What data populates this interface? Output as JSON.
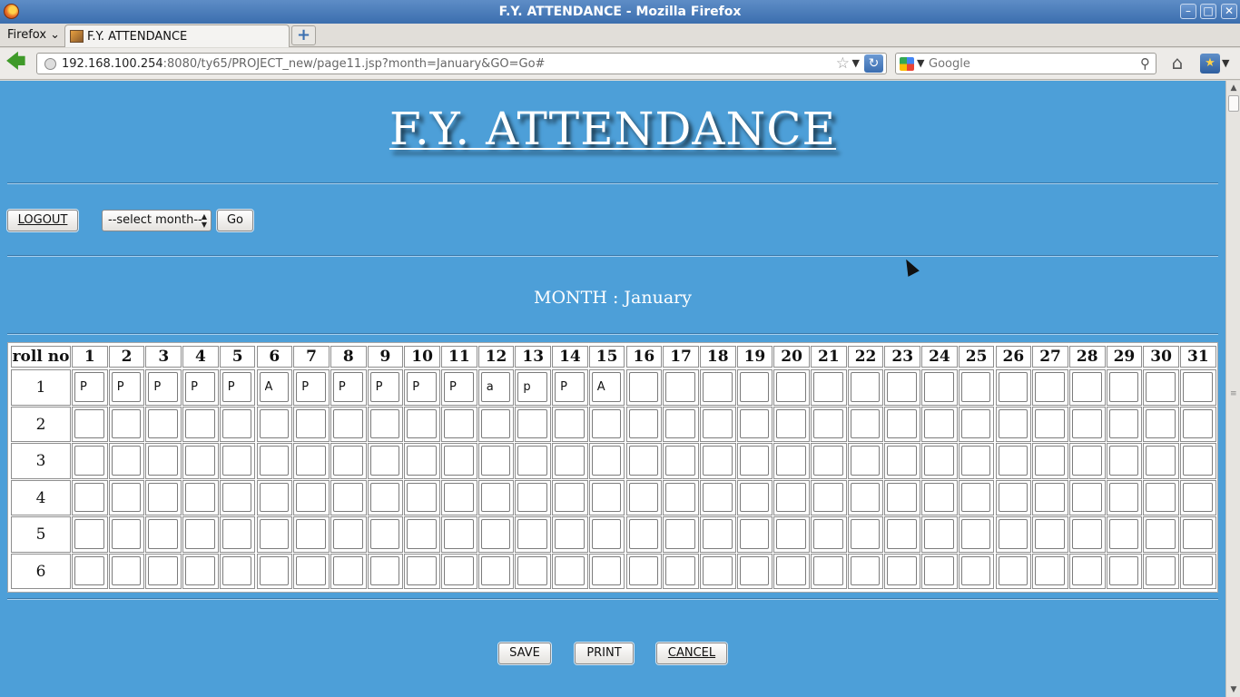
{
  "window": {
    "title": "F.Y. ATTENDANCE - Mozilla Firefox"
  },
  "browser": {
    "menu_label": "Firefox",
    "tab_title": "F.Y. ATTENDANCE",
    "url_host": "192.168.100.254",
    "url_rest": ":8080/ty65/PROJECT_new/page11.jsp?month=January&GO=Go#",
    "search_placeholder": "Google"
  },
  "page": {
    "title": "F.Y. ATTENDANCE",
    "logout_label": "LOGOUT",
    "month_select_value": "--select month--",
    "go_label": "Go",
    "month_prefix": "MONTH : ",
    "month_value": "January",
    "month_text": "MONTH : January",
    "save_label": "SAVE",
    "print_label": "PRINT",
    "cancel_label": "CANCEL"
  },
  "attendance": {
    "roll_header": "roll no",
    "days": [
      "1",
      "2",
      "3",
      "4",
      "5",
      "6",
      "7",
      "8",
      "9",
      "10",
      "11",
      "12",
      "13",
      "14",
      "15",
      "16",
      "17",
      "18",
      "19",
      "20",
      "21",
      "22",
      "23",
      "24",
      "25",
      "26",
      "27",
      "28",
      "29",
      "30",
      "31"
    ],
    "rows": [
      {
        "roll": "1",
        "marks": [
          "P",
          "P",
          "P",
          "P",
          "P",
          "A",
          "P",
          "P",
          "P",
          "P",
          "P",
          "a",
          "p",
          "P",
          "A",
          "",
          "",
          "",
          "",
          "",
          "",
          "",
          "",
          "",
          "",
          "",
          "",
          "",
          "",
          "",
          ""
        ]
      },
      {
        "roll": "2",
        "marks": [
          "",
          "",
          "",
          "",
          "",
          "",
          "",
          "",
          "",
          "",
          "",
          "",
          "",
          "",
          "",
          "",
          "",
          "",
          "",
          "",
          "",
          "",
          "",
          "",
          "",
          "",
          "",
          "",
          "",
          "",
          ""
        ]
      },
      {
        "roll": "3",
        "marks": [
          "",
          "",
          "",
          "",
          "",
          "",
          "",
          "",
          "",
          "",
          "",
          "",
          "",
          "",
          "",
          "",
          "",
          "",
          "",
          "",
          "",
          "",
          "",
          "",
          "",
          "",
          "",
          "",
          "",
          "",
          ""
        ]
      },
      {
        "roll": "4",
        "marks": [
          "",
          "",
          "",
          "",
          "",
          "",
          "",
          "",
          "",
          "",
          "",
          "",
          "",
          "",
          "",
          "",
          "",
          "",
          "",
          "",
          "",
          "",
          "",
          "",
          "",
          "",
          "",
          "",
          "",
          "",
          ""
        ]
      },
      {
        "roll": "5",
        "marks": [
          "",
          "",
          "",
          "",
          "",
          "",
          "",
          "",
          "",
          "",
          "",
          "",
          "",
          "",
          "",
          "",
          "",
          "",
          "",
          "",
          "",
          "",
          "",
          "",
          "",
          "",
          "",
          "",
          "",
          "",
          ""
        ]
      },
      {
        "roll": "6",
        "marks": [
          "",
          "",
          "",
          "",
          "",
          "",
          "",
          "",
          "",
          "",
          "",
          "",
          "",
          "",
          "",
          "",
          "",
          "",
          "",
          "",
          "",
          "",
          "",
          "",
          "",
          "",
          "",
          "",
          "",
          "",
          ""
        ]
      }
    ]
  }
}
